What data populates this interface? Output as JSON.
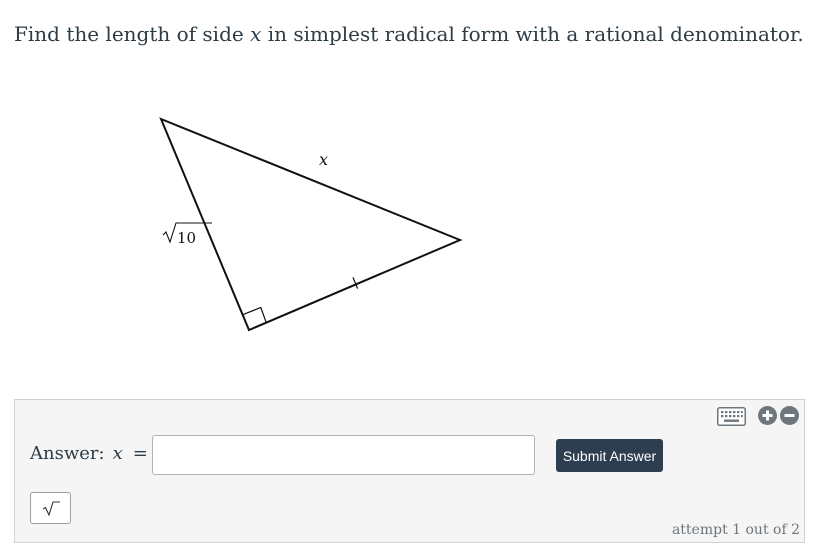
{
  "question": {
    "text_before": "Find the length of side ",
    "variable": "x",
    "text_after": " in simplest radical form with a rational denominator."
  },
  "figure": {
    "hypotenuse_label": "x",
    "leg_label_radicand": "10",
    "icons": [
      "right-angle-marker",
      "tick-mark",
      "radical-sign"
    ]
  },
  "answer": {
    "label": "Answer:",
    "variable": "x",
    "equals": "=",
    "input_value": "",
    "submit_label": "Submit Answer",
    "attempt_text": "attempt 1 out of 2"
  },
  "toolbar": {
    "icons": [
      "keyboard-icon",
      "zoom-in-icon",
      "zoom-out-icon",
      "square-root-icon"
    ]
  },
  "colors": {
    "submit_bg": "#2c3e50",
    "panel_bg": "#f5f5f6",
    "icon_gray": "#6e777d"
  }
}
